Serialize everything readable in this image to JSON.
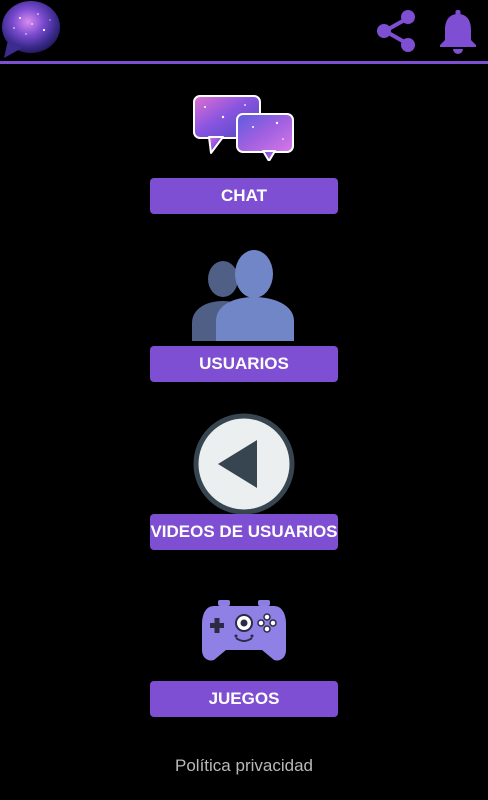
{
  "header": {
    "logo_icon": "galaxy-speech-bubble-icon",
    "share_icon": "share-icon",
    "bell_icon": "bell-icon",
    "accent_color": "#7e4fd2"
  },
  "menu": [
    {
      "icon": "chat-bubbles-icon",
      "label": "CHAT"
    },
    {
      "icon": "users-icon",
      "label": "USUARIOS"
    },
    {
      "icon": "play-back-icon",
      "label": "VIDEOS DE USUARIOS"
    },
    {
      "icon": "gamepad-icon",
      "label": "JUEGOS"
    }
  ],
  "footer": {
    "privacy_label": "Política privacidad"
  }
}
